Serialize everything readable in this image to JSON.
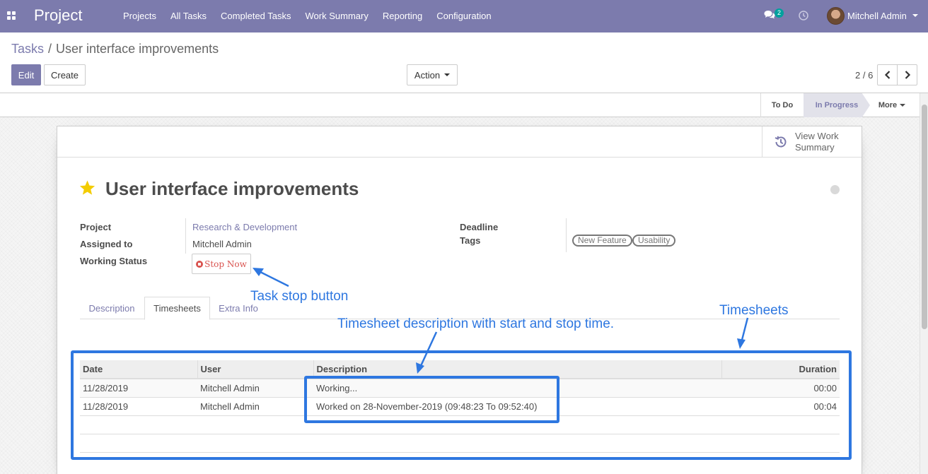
{
  "navbar": {
    "brand": "Project",
    "menu": [
      "Projects",
      "All Tasks",
      "Completed Tasks",
      "Work Summary",
      "Reporting",
      "Configuration"
    ],
    "chat_count": "2",
    "user_name": "Mitchell Admin",
    "colors": {
      "primary": "#7c7bad",
      "badge": "#00a09d"
    }
  },
  "breadcrumb": {
    "parent": "Tasks",
    "separator": "/",
    "current": "User interface improvements"
  },
  "toolbar": {
    "edit_label": "Edit",
    "create_label": "Create",
    "action_label": "Action"
  },
  "pager": {
    "value": "2 / 6"
  },
  "statusbar": {
    "stages": [
      "To Do",
      "In Progress"
    ],
    "active_stage": "In Progress",
    "more_label": "More"
  },
  "sheet": {
    "smart_button": {
      "label": "View Work Summary",
      "icon": "history-icon"
    },
    "title": "User interface improvements",
    "starred": true,
    "fields": {
      "project_label": "Project",
      "project_value": "Research & Development",
      "assigned_label": "Assigned to",
      "assigned_value": "Mitchell Admin",
      "working_status_label": "Working Status",
      "stop_button_label": "Stop Now",
      "deadline_label": "Deadline",
      "deadline_value": "",
      "tags_label": "Tags",
      "tags": [
        "New Feature",
        "Usability"
      ]
    },
    "tabs": [
      "Description",
      "Timesheets",
      "Extra Info"
    ],
    "active_tab": "Timesheets",
    "timesheets": {
      "columns": [
        "Date",
        "User",
        "Description",
        "Duration"
      ],
      "rows": [
        {
          "date": "11/28/2019",
          "user": "Mitchell Admin",
          "description": "Working...",
          "duration": "00:00"
        },
        {
          "date": "11/28/2019",
          "user": "Mitchell Admin",
          "description": "Worked on 28-November-2019 (09:48:23 To 09:52:40)",
          "duration": "00:04"
        }
      ]
    }
  },
  "annotations": {
    "stop_button_note": "Task stop button",
    "timesheets_note": "Timesheets",
    "description_note": "Timesheet description with start and stop time.",
    "color": "#2e77e0"
  }
}
